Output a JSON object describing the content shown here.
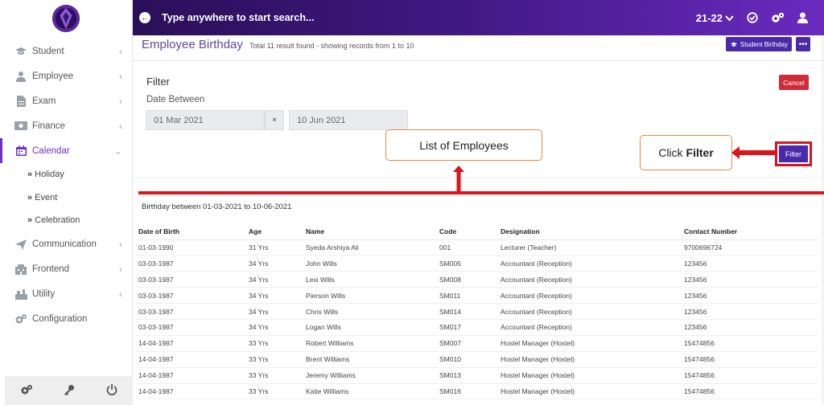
{
  "topbar": {
    "search_placeholder": "Type anywhere to start search...",
    "session": "21-22"
  },
  "sidebar": {
    "items": [
      {
        "label": "Student",
        "icon": "graduation-cap-icon"
      },
      {
        "label": "Employee",
        "icon": "user-icon"
      },
      {
        "label": "Exam",
        "icon": "document-icon"
      },
      {
        "label": "Finance",
        "icon": "money-icon"
      },
      {
        "label": "Calendar",
        "icon": "calendar-icon"
      },
      {
        "label": "Communication",
        "icon": "paper-plane-icon"
      },
      {
        "label": "Frontend",
        "icon": "building-icon"
      },
      {
        "label": "Utility",
        "icon": "utility-icon"
      },
      {
        "label": "Configuration",
        "icon": "gears-icon"
      }
    ],
    "calendar_sub": [
      "Holiday",
      "Event",
      "Celebration"
    ]
  },
  "page": {
    "title": "Employee Birthday",
    "subtitle": "Total 11 result found - showing records from 1 to 10",
    "student_birthday_btn": "Student Birthday"
  },
  "filter": {
    "title": "Filter",
    "date_label": "Date Between",
    "from": "01 Mar 2021",
    "clear": "×",
    "to": "10 Jun 2021",
    "cancel": "Cancel",
    "filter_btn": "Filter"
  },
  "callouts": {
    "list": "List of Employees",
    "click": "Click",
    "filter": "Filter"
  },
  "results": {
    "range_text": "Birthday between 01-03-2021 to 10-06-2021",
    "columns": [
      "Date of Birth",
      "Age",
      "Name",
      "Code",
      "Designation",
      "Contact Number"
    ],
    "rows": [
      [
        "01-03-1990",
        "31 Yrs",
        "Syeda Arshiya Ali",
        "001",
        "Lecturer (Teacher)",
        "9700696724"
      ],
      [
        "03-03-1987",
        "34 Yrs",
        "John Wills",
        "SM005",
        "Accountant (Reception)",
        "123456"
      ],
      [
        "03-03-1987",
        "34 Yrs",
        "Lexi Wills",
        "SM008",
        "Accountant (Reception)",
        "123456"
      ],
      [
        "03-03-1987",
        "34 Yrs",
        "Pierson Wills",
        "SM011",
        "Accountant (Reception)",
        "123456"
      ],
      [
        "03-03-1987",
        "34 Yrs",
        "Chris Wills",
        "SM014",
        "Accountant (Reception)",
        "123456"
      ],
      [
        "03-03-1987",
        "34 Yrs",
        "Logan Wills",
        "SM017",
        "Accountant (Reception)",
        "123456"
      ],
      [
        "14-04-1987",
        "33 Yrs",
        "Robert Williams",
        "SM007",
        "Hostel Manager (Hostel)",
        "15474856"
      ],
      [
        "14-04-1987",
        "33 Yrs",
        "Brent Williams",
        "SM010",
        "Hostel Manager (Hostel)",
        "15474856"
      ],
      [
        "14-04-1987",
        "33 Yrs",
        "Jeremy Williams",
        "SM013",
        "Hostel Manager (Hostel)",
        "15474856"
      ],
      [
        "14-04-1987",
        "33 Yrs",
        "Katie Williams",
        "SM016",
        "Hostel Manager (Hostel)",
        "15474856"
      ]
    ]
  },
  "colors": {
    "accent": "#4a2aa8",
    "topbar_start": "#2a0f58",
    "topbar_end": "#6a2ac0",
    "danger": "#d22b38",
    "annotation_red": "#dc141c",
    "callout_border": "#e98a3c"
  }
}
